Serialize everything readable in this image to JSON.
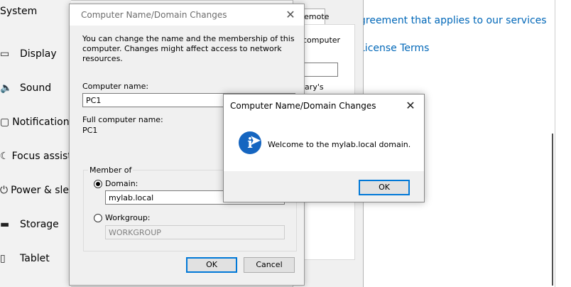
{
  "sidebar": {
    "title": "System",
    "items": [
      {
        "icon": "display-icon",
        "glyph": "▭",
        "label": "Display"
      },
      {
        "icon": "sound-icon",
        "glyph": "🔈",
        "label": "Sound"
      },
      {
        "icon": "notifications-icon",
        "glyph": "▢",
        "label": "Notifications"
      },
      {
        "icon": "focus-assist-icon",
        "glyph": "☾",
        "label": "Focus assist"
      },
      {
        "icon": "power-icon",
        "glyph": "⏻",
        "label": "Power & sleep"
      },
      {
        "icon": "storage-icon",
        "glyph": "▬",
        "label": "Storage"
      },
      {
        "icon": "tablet-icon",
        "glyph": "▯",
        "label": "Tablet"
      }
    ]
  },
  "background_window": {
    "tab_label": "Remote",
    "text1": "computer",
    "text2": "lary's"
  },
  "content": {
    "link1": "greement that applies to our services",
    "link2": "License Terms"
  },
  "dialog": {
    "title": "Computer Name/Domain Changes",
    "intro": "You can change the name and the membership of this computer. Changes might affect access to network resources.",
    "computer_name_label": "Computer name:",
    "computer_name_value": "PC1",
    "full_name_label": "Full computer name:",
    "full_name_value": "PC1",
    "member_of_label": "Member of",
    "domain_label": "Domain:",
    "domain_value": "mylab.local",
    "workgroup_label": "Workgroup:",
    "workgroup_value": "WORKGROUP",
    "selected": "domain",
    "ok_label": "OK",
    "cancel_label": "Cancel"
  },
  "message_box": {
    "title": "Computer Name/Domain Changes",
    "message": "Welcome to the mylab.local domain.",
    "icon": "info-icon",
    "ok_label": "OK"
  },
  "colors": {
    "link": "#0067b8",
    "focus": "#0078d7",
    "info_icon": "#1565c0"
  }
}
